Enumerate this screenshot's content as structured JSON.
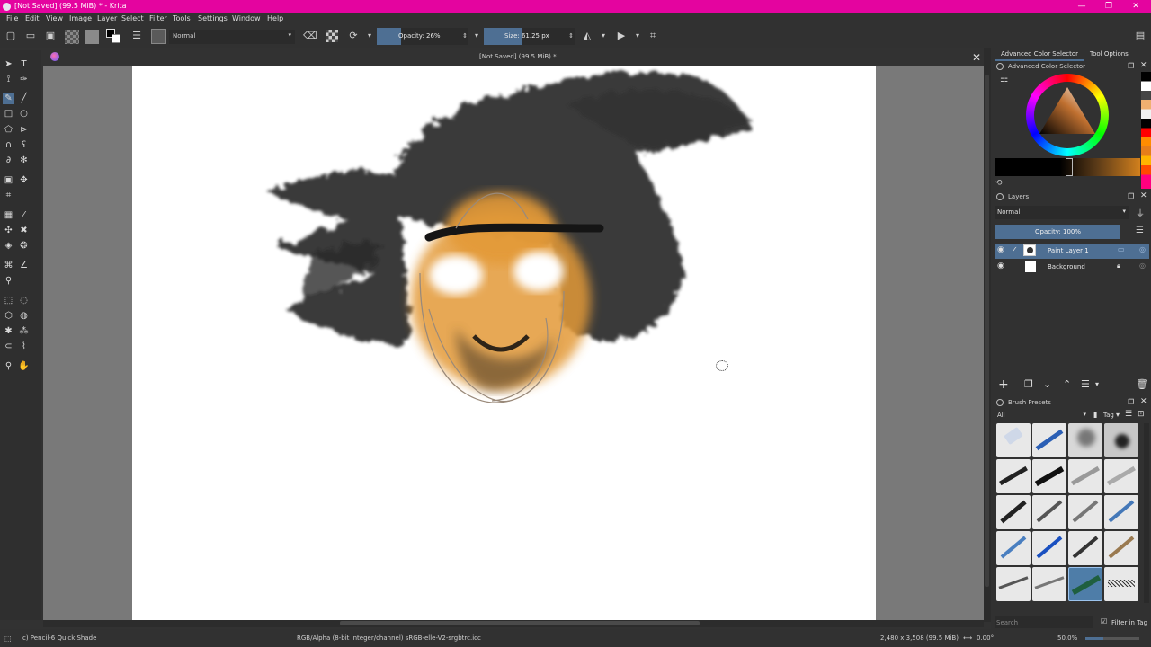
{
  "window": {
    "title": "[Not Saved]  (99.5 MiB) * - Krita",
    "minimize": "—",
    "maximize": "❐",
    "close": "✕"
  },
  "menu": [
    "File",
    "Edit",
    "View",
    "Image",
    "Layer",
    "Select",
    "Filter",
    "Tools",
    "Settings",
    "Window",
    "Help"
  ],
  "toolbar": {
    "blend_mode": "Normal",
    "opacity_label": "Opacity: 26%",
    "opacity_value": 0.26,
    "size_label": "Size: 61.25 px"
  },
  "document": {
    "tab_title": "[Not Saved]  (99.5 MiB) *",
    "close": "✕"
  },
  "dock": {
    "tabs": [
      "Advanced Color Selector",
      "Tool Options"
    ],
    "color_selector_title": "Advanced Color Selector",
    "layers_title": "Layers",
    "layers_blend": "Normal",
    "layers_opacity": "Opacity:  100%",
    "layers": [
      {
        "name": "Paint Layer 1",
        "selected": true
      },
      {
        "name": "Background",
        "selected": false
      }
    ],
    "brush_presets_title": "Brush Presets",
    "brush_filter": "All",
    "tag_label": "Tag",
    "search_placeholder": "Search",
    "filter_in_tag": "Filter in Tag"
  },
  "status": {
    "brush": "c) Pencil-6 Quick Shade",
    "color_space": "RGB/Alpha (8-bit integer/channel)  sRGB-elle-V2-srgbtrc.icc",
    "dimensions": "2,480 x 3,508 (99.5 MiB)",
    "rotation": "0.00°",
    "zoom": "50.0%"
  },
  "colors": {
    "titlebar": "#e4049f",
    "accent": "#4e6f93",
    "panel": "#313131",
    "canvas_bg": "#797979"
  }
}
